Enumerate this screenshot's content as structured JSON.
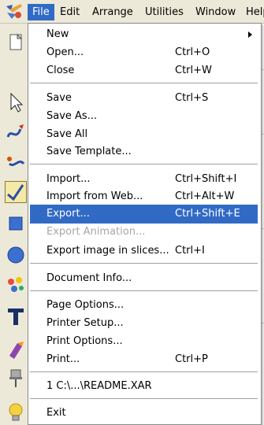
{
  "menubar": {
    "items": [
      "File",
      "Edit",
      "Arrange",
      "Utilities",
      "Window",
      "Help"
    ]
  },
  "file_menu": {
    "items": [
      {
        "label": "New",
        "shortcut": "",
        "submenu": true
      },
      {
        "label": "Open...",
        "shortcut": "Ctrl+O"
      },
      {
        "label": "Close",
        "shortcut": "Ctrl+W"
      },
      {
        "label": "Save",
        "shortcut": "Ctrl+S"
      },
      {
        "label": "Save As...",
        "shortcut": ""
      },
      {
        "label": "Save All",
        "shortcut": ""
      },
      {
        "label": "Save Template...",
        "shortcut": ""
      },
      {
        "label": "Import...",
        "shortcut": "Ctrl+Shift+I"
      },
      {
        "label": "Import from Web...",
        "shortcut": "Ctrl+Alt+W"
      },
      {
        "label": "Export...",
        "shortcut": "Ctrl+Shift+E",
        "highlighted": true
      },
      {
        "label": "Export Animation...",
        "shortcut": "",
        "disabled": true
      },
      {
        "label": "Export image in slices...",
        "shortcut": "Ctrl+I"
      },
      {
        "label": "Document Info...",
        "shortcut": ""
      },
      {
        "label": "Page Options...",
        "shortcut": ""
      },
      {
        "label": "Printer Setup...",
        "shortcut": ""
      },
      {
        "label": "Print Options...",
        "shortcut": ""
      },
      {
        "label": "Print...",
        "shortcut": "Ctrl+P"
      },
      {
        "label": "1 C:\\...\\README.XAR",
        "shortcut": ""
      },
      {
        "label": "Exit",
        "shortcut": ""
      }
    ]
  },
  "colors": {
    "highlight": "#316ac5",
    "disabled_text": "#a7a6aa"
  },
  "toolbar_icons": [
    "new-document-icon",
    "selector-arrow-icon",
    "freehand-pen-icon",
    "shape-editor-icon",
    "line-tool-icon",
    "rectangle-icon",
    "ellipse-icon",
    "gradient-fill-icon",
    "text-icon",
    "paint-icon",
    "push-pin-icon",
    "light-bulb-icon"
  ]
}
